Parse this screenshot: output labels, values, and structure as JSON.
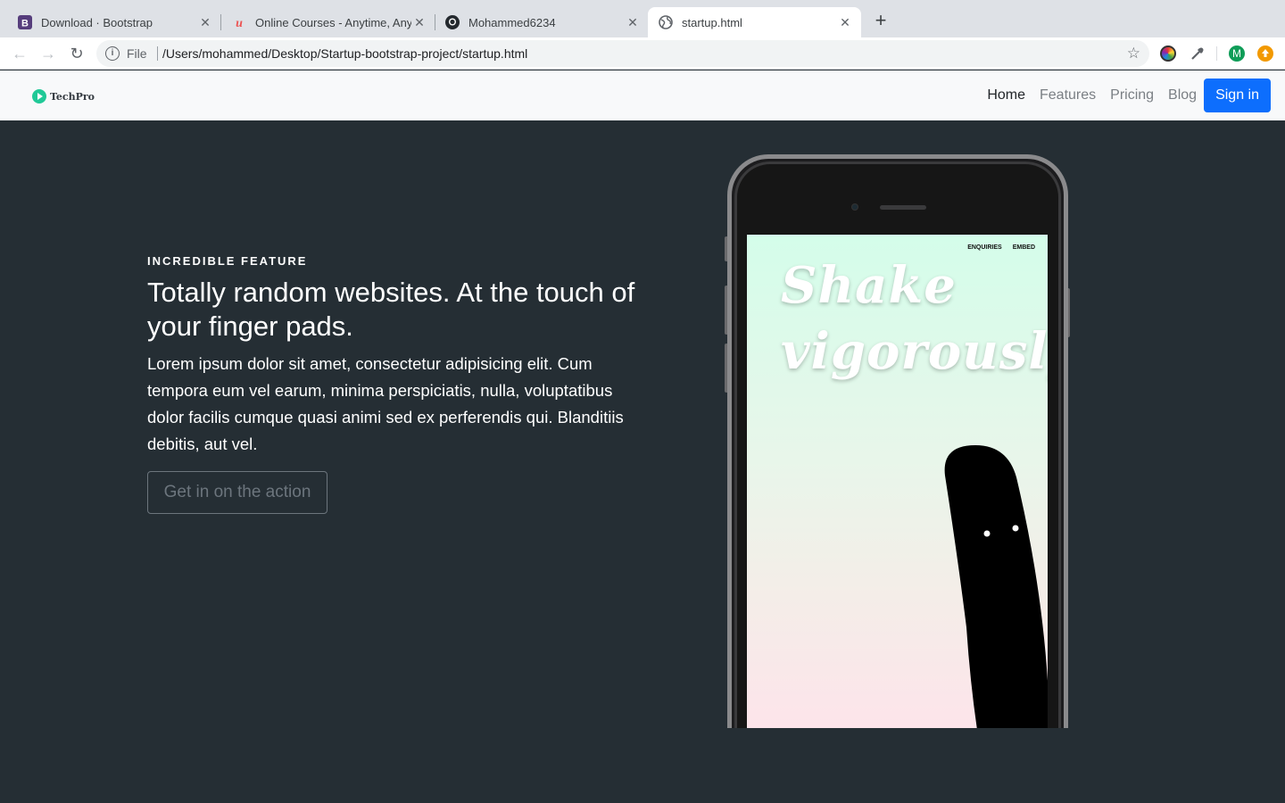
{
  "browser": {
    "tabs": [
      {
        "title": "Download · Bootstrap",
        "icon": "bootstrap-icon"
      },
      {
        "title": "Online Courses - Anytime, Anywhere",
        "icon": "udemy-icon"
      },
      {
        "title": "Mohammed6234",
        "icon": "github-icon"
      },
      {
        "title": "startup.html",
        "icon": "globe-icon",
        "active": true
      }
    ],
    "omnibox": {
      "scheme_label": "File",
      "url": "/Users/mohammed/Desktop/Startup-bootstrap-project/startup.html"
    },
    "profile_initial": "M"
  },
  "navbar": {
    "brand": "TechPro",
    "links": [
      "Home",
      "Features",
      "Pricing",
      "Blog"
    ],
    "active_link": "Home",
    "signin": "Sign in",
    "accent": "#0d6efd"
  },
  "hero": {
    "eyebrow": "INCREDIBLE FEATURE",
    "headline": "Totally random websites. At the touch of your finger pads.",
    "lead": "Lorem ipsum dolor sit amet, consectetur adipisicing elit. Cum tempora eum vel earum, minima perspiciatis, nulla, voluptatibus dolor facilis cumque quasi animi sed ex perferendis qui. Blanditiis debitis, aut vel.",
    "cta": "Get in on the action",
    "background": "#252e34"
  },
  "phone_screen": {
    "nav": [
      "ENQUIRIES",
      "EMBED"
    ],
    "line1": "Shake",
    "line2": "vigorously"
  }
}
